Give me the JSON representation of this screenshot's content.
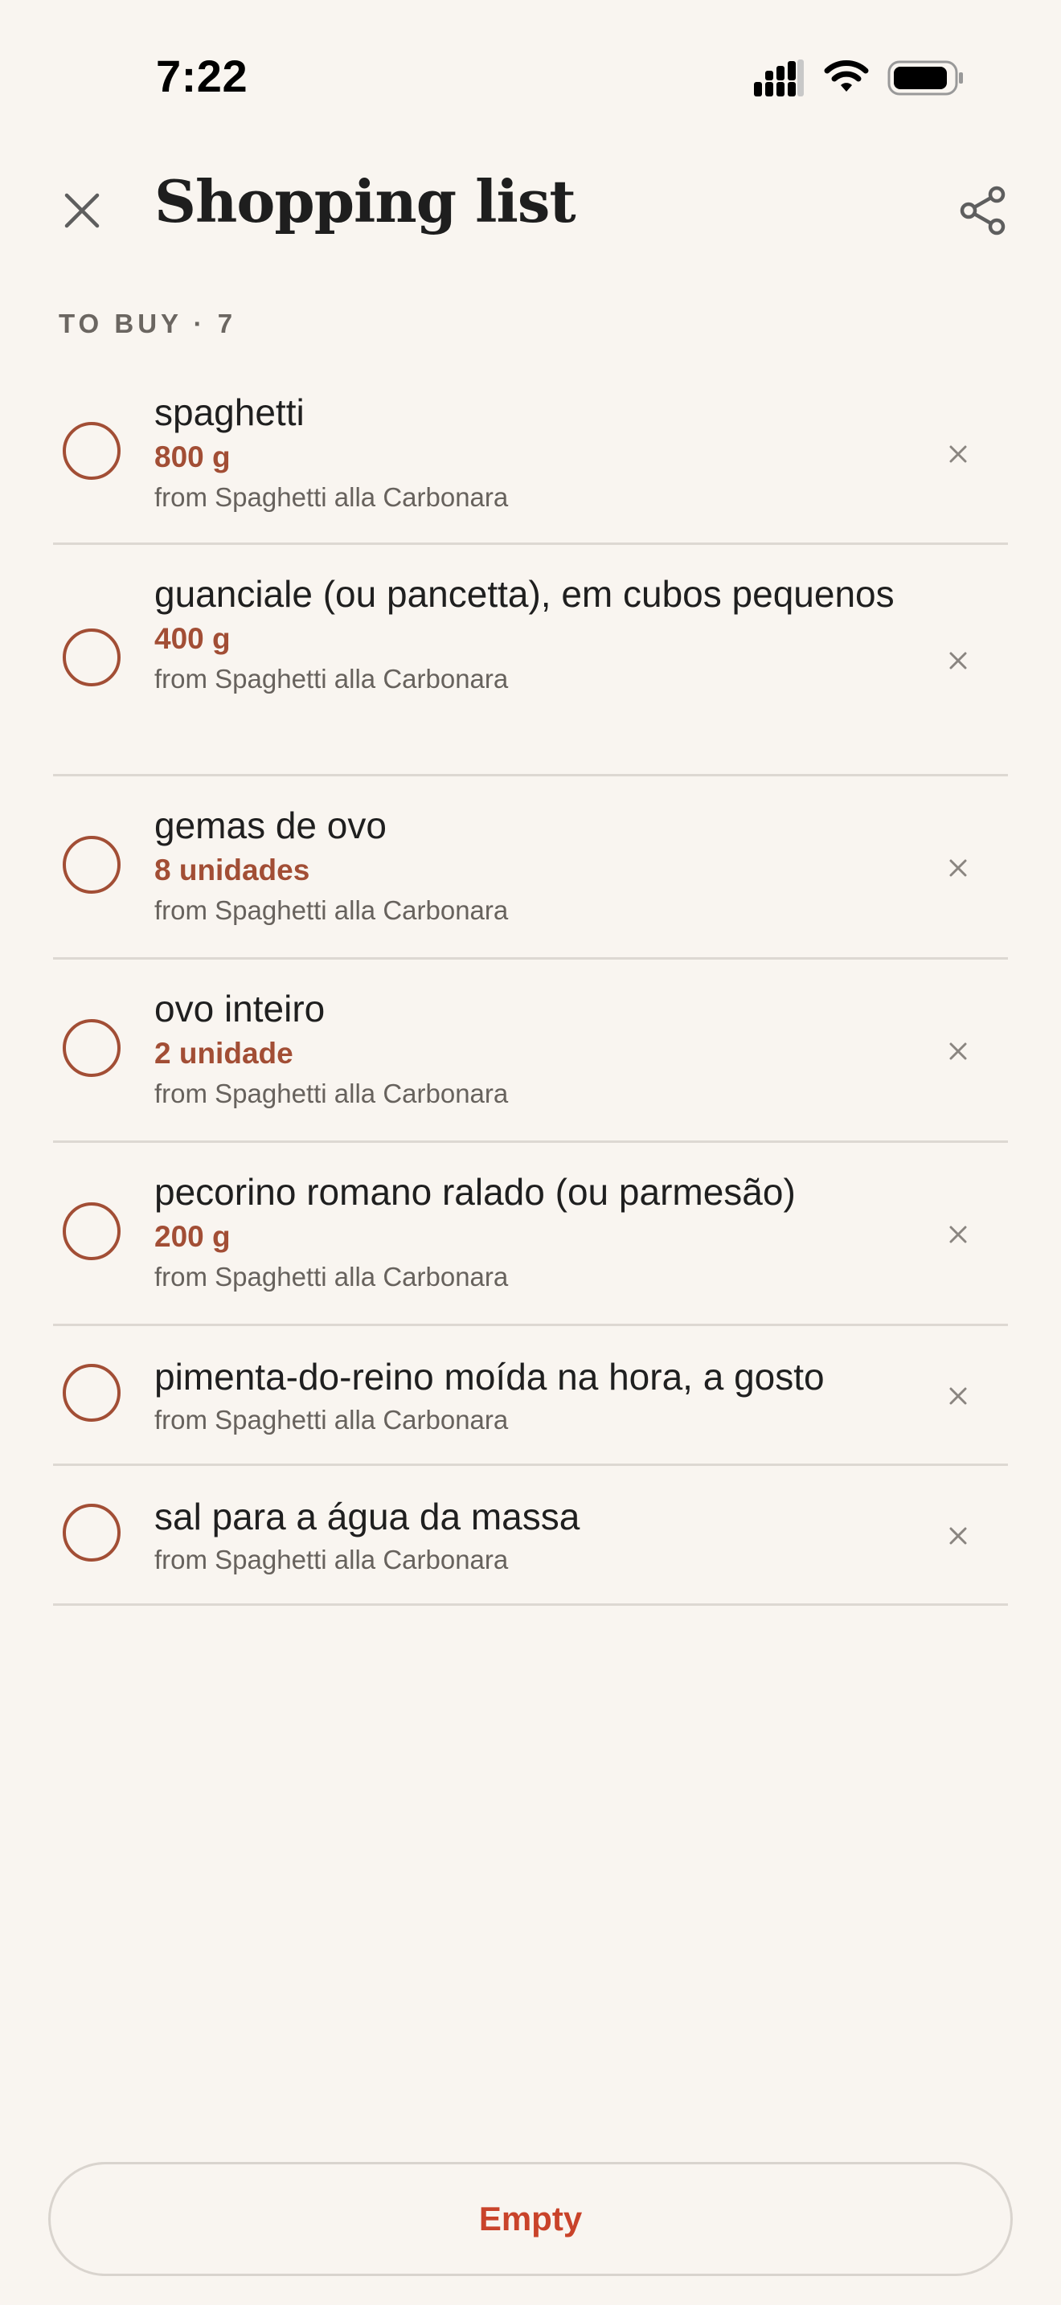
{
  "status_bar": {
    "time": "7:22"
  },
  "header": {
    "title": "Shopping list",
    "close_icon": "close-icon",
    "share_icon": "share-icon"
  },
  "section": {
    "label": "TO BUY · 7"
  },
  "items": [
    {
      "name": "spaghetti",
      "quantity": "800 g",
      "source": "from Spaghetti alla Carbonara"
    },
    {
      "name": "guanciale (ou pancetta), em cubos pequenos",
      "quantity": "400 g",
      "source": "from Spaghetti alla Carbonara"
    },
    {
      "name": "gemas de ovo",
      "quantity": "8 unidades",
      "source": "from Spaghetti alla Carbonara"
    },
    {
      "name": "ovo inteiro",
      "quantity": "2 unidade",
      "source": "from Spaghetti alla Carbonara"
    },
    {
      "name": "pecorino romano ralado (ou parmesão)",
      "quantity": "200 g",
      "source": "from Spaghetti alla Carbonara"
    },
    {
      "name": "pimenta-do-reino moída na hora, a gosto",
      "source": "from Spaghetti alla Carbonara"
    },
    {
      "name": "sal para a água da massa",
      "source": "from Spaghetti alla Carbonara"
    }
  ],
  "footer": {
    "empty_label": "Empty"
  },
  "colors": {
    "accent": "#A24E35",
    "danger": "#C9432A",
    "background": "#F9F5F0"
  }
}
